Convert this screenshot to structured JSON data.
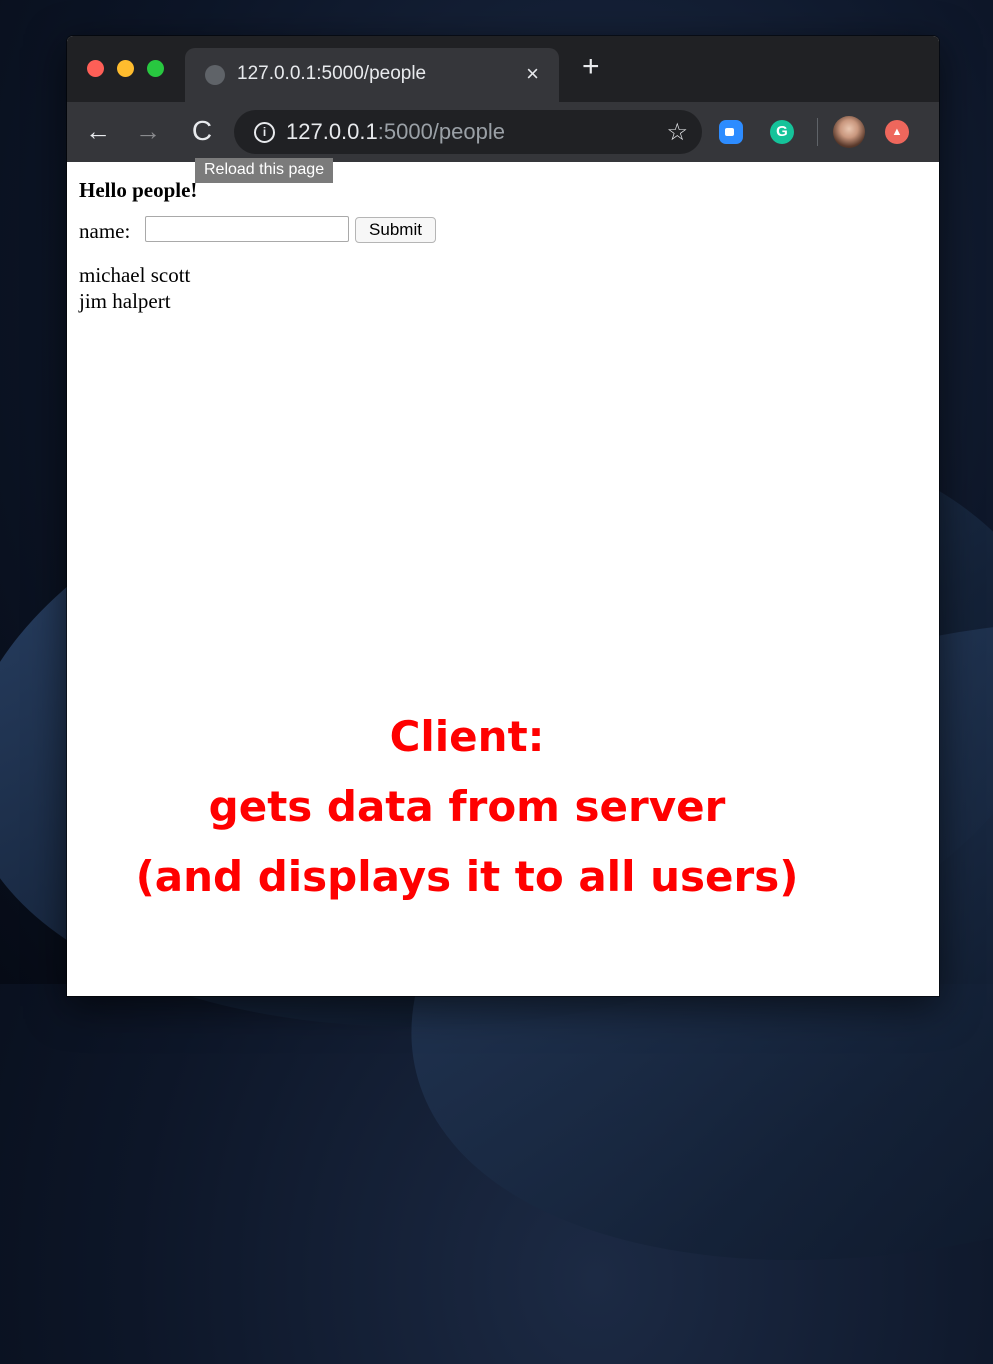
{
  "browser": {
    "tab": {
      "title": "127.0.0.1:5000/people",
      "close_glyph": "×",
      "favicon": "globe-icon"
    },
    "new_tab_glyph": "+",
    "toolbar": {
      "back_glyph": "←",
      "forward_glyph": "→",
      "reload_glyph": "C",
      "url_host": "127.0.0.1",
      "url_path": ":5000/people",
      "bookmark_glyph": "☆",
      "extensions": [
        "zoom-icon",
        "grammarly-icon",
        "profile-avatar",
        "upload-extension-icon"
      ]
    },
    "tooltip": "Reload this page"
  },
  "page": {
    "heading": "Hello people!",
    "form": {
      "label": "name:",
      "input_value": "",
      "submit_label": "Submit"
    },
    "people": [
      "michael scott",
      "jim halpert"
    ]
  },
  "annotation": {
    "lines": [
      "Client:",
      "gets data from server",
      "(and displays it to all users)"
    ],
    "color": "#ff0000"
  }
}
